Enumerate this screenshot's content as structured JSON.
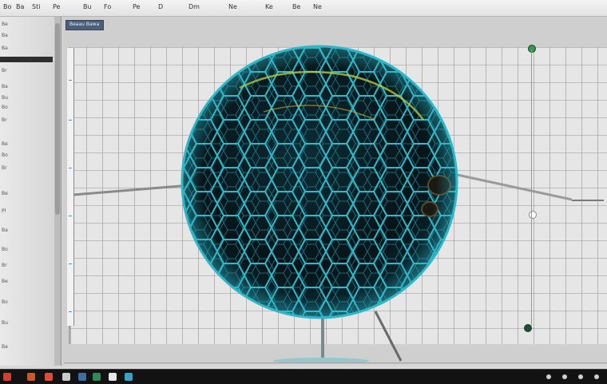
{
  "menubar": {
    "items": [
      "Bo",
      "Ba",
      "Sti",
      "Pe",
      "Bu",
      "Fo",
      "Pe",
      "D",
      "Dm",
      "Ne",
      "Ke",
      "Be",
      "Ne"
    ]
  },
  "toolbar": {
    "tab_label": "Beaau Bawa"
  },
  "sidebar": {
    "labels": [
      "Be",
      "Ba",
      "Ba",
      "Br",
      "Ba",
      "Bu",
      "Bo",
      "Br",
      "Be",
      "Bo",
      "Br",
      "Be",
      "Pl",
      "Ba",
      "Bo",
      "Br",
      "Be",
      "Bo",
      "Bu",
      "Ba"
    ]
  },
  "taskbar": {
    "icons": [
      "start-icon",
      "file-explorer-icon",
      "browser-icon",
      "mail-icon",
      "terminal-icon",
      "spreadsheet-icon",
      "document-icon",
      "image-icon"
    ],
    "tray": [
      "network-icon",
      "volume-icon",
      "battery-icon",
      "clock-icon"
    ]
  },
  "colors": {
    "sphere_mesh": "#2fb7c8",
    "sphere_core": "#081a20",
    "sphere_highlight": "#b9c83a",
    "handle_green": "#2f9a4f",
    "tab": "#4c5f7a"
  },
  "scene": {
    "object": "wireframe-sphere",
    "grid": true
  }
}
